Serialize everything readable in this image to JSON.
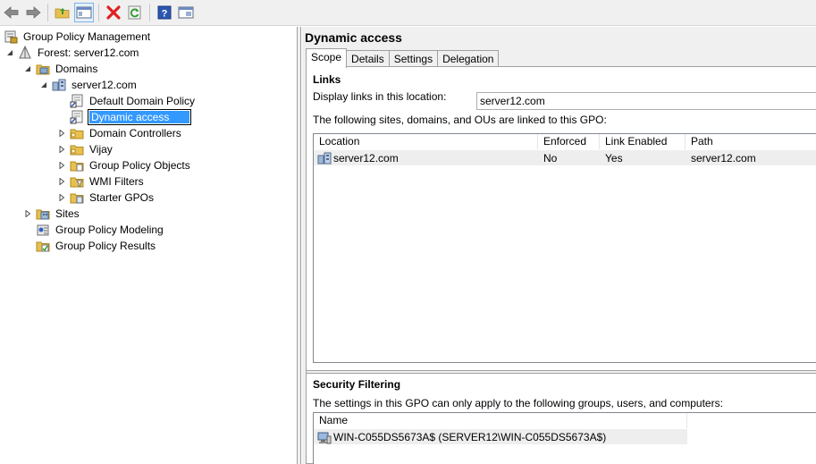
{
  "toolbar": {
    "buttons": [
      {
        "name": "back-arrow-icon"
      },
      {
        "name": "forward-arrow-icon"
      },
      {
        "name": "up-folder-icon"
      },
      {
        "name": "show-hide-tree-icon"
      },
      {
        "name": "delete-icon"
      },
      {
        "name": "refresh-icon"
      },
      {
        "name": "help-icon"
      },
      {
        "name": "properties-icon"
      }
    ]
  },
  "tree": {
    "root": "Group Policy Management",
    "forest": "Forest: server12.com",
    "domains": "Domains",
    "domain": "server12.com",
    "default_policy": "Default Domain Policy",
    "dynamic_access": "Dynamic access",
    "domain_controllers": "Domain Controllers",
    "vijay": "Vijay",
    "gpo_objects": "Group Policy Objects",
    "wmi_filters": "WMI Filters",
    "starter_gpos": "Starter GPOs",
    "sites": "Sites",
    "modeling": "Group Policy Modeling",
    "results": "Group Policy Results"
  },
  "gpo": {
    "title": "Dynamic access",
    "tabs": [
      "Scope",
      "Details",
      "Settings",
      "Delegation"
    ],
    "links": {
      "heading": "Links",
      "display_label": "Display links in this location:",
      "location_value": "server12.com",
      "linked_text": "The following sites, domains, and OUs are linked to this GPO:",
      "columns": [
        "Location",
        "Enforced",
        "Link Enabled",
        "Path"
      ],
      "rows": [
        {
          "location": "server12.com",
          "enforced": "No",
          "link_enabled": "Yes",
          "path": "server12.com"
        }
      ]
    },
    "security": {
      "heading": "Security Filtering",
      "description": "The settings in this GPO can only apply to the following groups, users, and computers:",
      "columns": [
        "Name"
      ],
      "rows": [
        {
          "name": "WIN-C055DS5673A$ (SERVER12\\WIN-C055DS5673A$)"
        }
      ]
    }
  },
  "colors": {
    "selection": "#3399ff",
    "delete_red": "#e02020",
    "folder_yellow": "#e8c050"
  }
}
